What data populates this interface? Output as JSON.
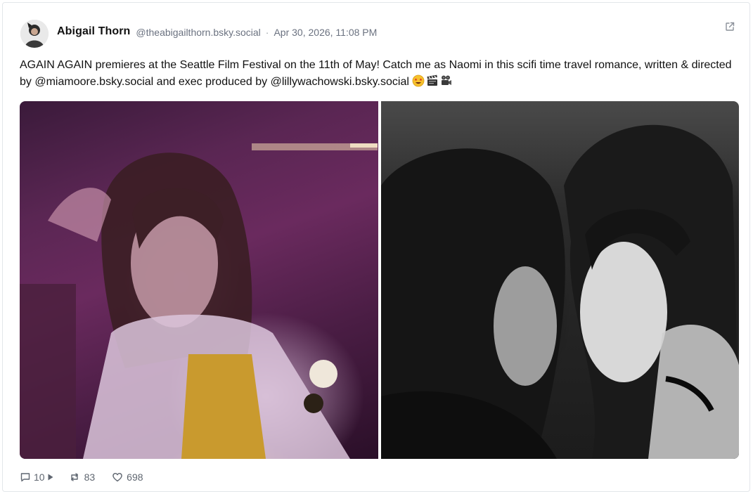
{
  "post": {
    "author": {
      "display_name": "Abigail Thorn",
      "handle": "@theabigailthorn.bsky.social"
    },
    "separator": "·",
    "timestamp": "Apr 30, 2026, 11:08 PM",
    "text": {
      "part1": "AGAIN AGAIN premieres at the Seattle Film Festival on the 11th of May! Catch me as Naomi in this scifi time travel romance, written & directed by ",
      "mention1": "@miamoore.bsky.social",
      "part2": " and exec produced by ",
      "mention2": "@lillywachowski.bsky.social",
      "part3": " ",
      "emojis": [
        "star-struck-emoji",
        "clapper-board-emoji",
        "movie-camera-emoji"
      ]
    },
    "images": [
      {
        "name": "film-still-color",
        "tone": "purple"
      },
      {
        "name": "film-still-bw",
        "tone": "grayscale"
      }
    ],
    "stats": {
      "replies": "10",
      "reposts": "83",
      "likes": "698"
    },
    "icons": {
      "reply": "speech-bubble-icon",
      "thread": "play-triangle-icon",
      "repost": "repost-arrows-icon",
      "like": "heart-icon",
      "open": "external-link-icon"
    },
    "colors": {
      "text": "#111111",
      "muted": "#6b7280",
      "border": "#e3e6ea"
    }
  }
}
